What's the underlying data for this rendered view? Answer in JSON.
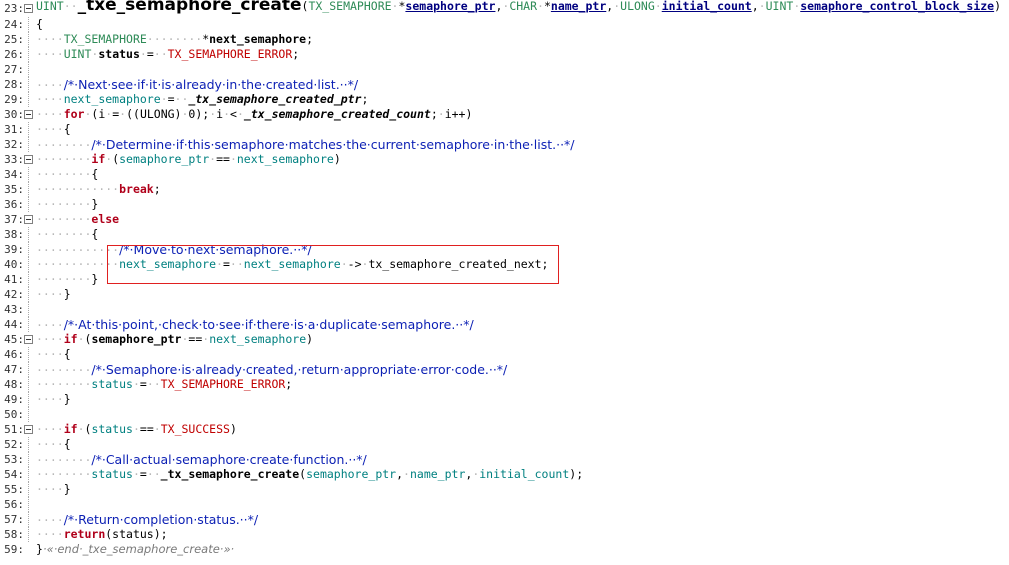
{
  "lines": [
    {
      "n": "23",
      "fold": true,
      "guide": false,
      "tokens": [
        [
          "type",
          "UINT"
        ],
        [
          "ws",
          "··"
        ],
        [
          "func",
          "_txe_semaphore_create"
        ],
        [
          "plain",
          "("
        ],
        [
          "type",
          "TX_SEMAPHORE"
        ],
        [
          "ws",
          "·"
        ],
        [
          "plain",
          "*"
        ],
        [
          "param",
          "semaphore_ptr"
        ],
        [
          "plain",
          ","
        ],
        [
          "ws",
          "·"
        ],
        [
          "type",
          "CHAR"
        ],
        [
          "ws",
          "·"
        ],
        [
          "plain",
          "*"
        ],
        [
          "param",
          "name_ptr"
        ],
        [
          "plain",
          ","
        ],
        [
          "ws",
          "·"
        ],
        [
          "type",
          "ULONG"
        ],
        [
          "ws",
          "·"
        ],
        [
          "param",
          "initial_count"
        ],
        [
          "plain",
          ","
        ],
        [
          "ws",
          "·"
        ],
        [
          "type",
          "UINT"
        ],
        [
          "ws",
          "·"
        ],
        [
          "param",
          "semaphore_control_block_size"
        ],
        [
          "plain",
          ")"
        ]
      ]
    },
    {
      "n": "24",
      "fold": false,
      "guide": true,
      "tokens": [
        [
          "plain",
          "{"
        ]
      ]
    },
    {
      "n": "25",
      "fold": false,
      "guide": true,
      "tokens": [
        [
          "ws",
          "····"
        ],
        [
          "type",
          "TX_SEMAPHORE"
        ],
        [
          "ws",
          "········"
        ],
        [
          "plain",
          "*"
        ],
        [
          "var",
          "next_semaphore"
        ],
        [
          "plain",
          ";"
        ]
      ]
    },
    {
      "n": "26",
      "fold": false,
      "guide": true,
      "tokens": [
        [
          "ws",
          "····"
        ],
        [
          "type",
          "UINT"
        ],
        [
          "ws",
          "·"
        ],
        [
          "var",
          "status"
        ],
        [
          "ws",
          "·"
        ],
        [
          "plain",
          "="
        ],
        [
          "ws",
          "··"
        ],
        [
          "const",
          "TX_SEMAPHORE_ERROR"
        ],
        [
          "plain",
          ";"
        ]
      ]
    },
    {
      "n": "27",
      "fold": false,
      "guide": true,
      "tokens": []
    },
    {
      "n": "28",
      "fold": false,
      "guide": true,
      "tokens": [
        [
          "ws",
          "····"
        ],
        [
          "comment",
          "/*·Next·see·if·it·is·already·in·the·created·list.··*/"
        ]
      ]
    },
    {
      "n": "29",
      "fold": false,
      "guide": true,
      "tokens": [
        [
          "ws",
          "····"
        ],
        [
          "ident",
          "next_semaphore"
        ],
        [
          "ws",
          "·"
        ],
        [
          "plain",
          "="
        ],
        [
          "ws",
          "··"
        ],
        [
          "global",
          "_tx_semaphore_created_ptr"
        ],
        [
          "plain",
          ";"
        ]
      ]
    },
    {
      "n": "30",
      "fold": true,
      "guide": false,
      "tokens": [
        [
          "ws",
          "····"
        ],
        [
          "keyword",
          "for"
        ],
        [
          "ws",
          "·"
        ],
        [
          "plain",
          "(i"
        ],
        [
          "ws",
          "·"
        ],
        [
          "plain",
          "="
        ],
        [
          "ws",
          "·"
        ],
        [
          "plain",
          "((ULONG)"
        ],
        [
          "ws",
          "·"
        ],
        [
          "plain",
          "0);"
        ],
        [
          "ws",
          "·"
        ],
        [
          "plain",
          "i"
        ],
        [
          "ws",
          "·"
        ],
        [
          "plain",
          "<"
        ],
        [
          "ws",
          "·"
        ],
        [
          "global",
          "_tx_semaphore_created_count"
        ],
        [
          "plain",
          ";"
        ],
        [
          "ws",
          "·"
        ],
        [
          "plain",
          "i++)"
        ]
      ]
    },
    {
      "n": "31",
      "fold": false,
      "guide": true,
      "tokens": [
        [
          "ws",
          "····"
        ],
        [
          "plain",
          "{"
        ]
      ]
    },
    {
      "n": "32",
      "fold": false,
      "guide": true,
      "tokens": [
        [
          "ws",
          "········"
        ],
        [
          "comment",
          "/*·Determine·if·this·semaphore·matches·the·current·semaphore·in·the·list.··*/"
        ]
      ]
    },
    {
      "n": "33",
      "fold": true,
      "guide": false,
      "tokens": [
        [
          "ws",
          "········"
        ],
        [
          "keyword",
          "if"
        ],
        [
          "ws",
          "·"
        ],
        [
          "plain",
          "("
        ],
        [
          "ident",
          "semaphore_ptr"
        ],
        [
          "ws",
          "·"
        ],
        [
          "plain",
          "=="
        ],
        [
          "ws",
          "·"
        ],
        [
          "ident",
          "next_semaphore"
        ],
        [
          "plain",
          ")"
        ]
      ]
    },
    {
      "n": "34",
      "fold": false,
      "guide": true,
      "tokens": [
        [
          "ws",
          "········"
        ],
        [
          "plain",
          "{"
        ]
      ]
    },
    {
      "n": "35",
      "fold": false,
      "guide": true,
      "tokens": [
        [
          "ws",
          "············"
        ],
        [
          "keyword",
          "break"
        ],
        [
          "plain",
          ";"
        ]
      ]
    },
    {
      "n": "36",
      "fold": false,
      "guide": true,
      "tokens": [
        [
          "ws",
          "········"
        ],
        [
          "plain",
          "}"
        ]
      ]
    },
    {
      "n": "37",
      "fold": true,
      "guide": false,
      "tokens": [
        [
          "ws",
          "········"
        ],
        [
          "keyword",
          "else"
        ]
      ]
    },
    {
      "n": "38",
      "fold": false,
      "guide": true,
      "tokens": [
        [
          "ws",
          "········"
        ],
        [
          "plain",
          "{"
        ]
      ]
    },
    {
      "n": "39",
      "fold": false,
      "guide": true,
      "tokens": [
        [
          "ws",
          "············"
        ],
        [
          "comment",
          "/*·Move·to·next·semaphore.··*/"
        ]
      ]
    },
    {
      "n": "40",
      "fold": false,
      "guide": true,
      "tokens": [
        [
          "ws",
          "············"
        ],
        [
          "ident",
          "next_semaphore"
        ],
        [
          "ws",
          "·"
        ],
        [
          "plain",
          "="
        ],
        [
          "ws",
          "··"
        ],
        [
          "ident",
          "next_semaphore"
        ],
        [
          "ws",
          "·"
        ],
        [
          "plain",
          "->"
        ],
        [
          "ws",
          "·"
        ],
        [
          "plain",
          "tx_semaphore_created_next;"
        ]
      ]
    },
    {
      "n": "41",
      "fold": false,
      "guide": true,
      "tokens": [
        [
          "ws",
          "········"
        ],
        [
          "plain",
          "}"
        ]
      ]
    },
    {
      "n": "42",
      "fold": false,
      "guide": true,
      "tokens": [
        [
          "ws",
          "····"
        ],
        [
          "plain",
          "}"
        ]
      ]
    },
    {
      "n": "43",
      "fold": false,
      "guide": true,
      "tokens": []
    },
    {
      "n": "44",
      "fold": false,
      "guide": true,
      "tokens": [
        [
          "ws",
          "····"
        ],
        [
          "comment",
          "/*·At·this·point,·check·to·see·if·there·is·a·duplicate·semaphore.··*/"
        ]
      ]
    },
    {
      "n": "45",
      "fold": true,
      "guide": false,
      "tokens": [
        [
          "ws",
          "····"
        ],
        [
          "keyword",
          "if"
        ],
        [
          "ws",
          "·"
        ],
        [
          "plain",
          "("
        ],
        [
          "var",
          "semaphore_ptr"
        ],
        [
          "ws",
          "·"
        ],
        [
          "plain",
          "=="
        ],
        [
          "ws",
          "·"
        ],
        [
          "ident",
          "next_semaphore"
        ],
        [
          "plain",
          ")"
        ]
      ]
    },
    {
      "n": "46",
      "fold": false,
      "guide": true,
      "tokens": [
        [
          "ws",
          "····"
        ],
        [
          "plain",
          "{"
        ]
      ]
    },
    {
      "n": "47",
      "fold": false,
      "guide": true,
      "tokens": [
        [
          "ws",
          "········"
        ],
        [
          "comment",
          "/*·Semaphore·is·already·created,·return·appropriate·error·code.··*/"
        ]
      ]
    },
    {
      "n": "48",
      "fold": false,
      "guide": true,
      "tokens": [
        [
          "ws",
          "········"
        ],
        [
          "ident",
          "status"
        ],
        [
          "ws",
          "·"
        ],
        [
          "plain",
          "="
        ],
        [
          "ws",
          "··"
        ],
        [
          "const",
          "TX_SEMAPHORE_ERROR"
        ],
        [
          "plain",
          ";"
        ]
      ]
    },
    {
      "n": "49",
      "fold": false,
      "guide": true,
      "tokens": [
        [
          "ws",
          "····"
        ],
        [
          "plain",
          "}"
        ]
      ]
    },
    {
      "n": "50",
      "fold": false,
      "guide": true,
      "tokens": []
    },
    {
      "n": "51",
      "fold": true,
      "guide": false,
      "tokens": [
        [
          "ws",
          "····"
        ],
        [
          "keyword",
          "if"
        ],
        [
          "ws",
          "·"
        ],
        [
          "plain",
          "("
        ],
        [
          "ident",
          "status"
        ],
        [
          "ws",
          "·"
        ],
        [
          "plain",
          "=="
        ],
        [
          "ws",
          "·"
        ],
        [
          "const",
          "TX_SUCCESS"
        ],
        [
          "plain",
          ")"
        ]
      ]
    },
    {
      "n": "52",
      "fold": false,
      "guide": true,
      "tokens": [
        [
          "ws",
          "····"
        ],
        [
          "plain",
          "{"
        ]
      ]
    },
    {
      "n": "53",
      "fold": false,
      "guide": true,
      "tokens": [
        [
          "ws",
          "········"
        ],
        [
          "comment",
          "/*·Call·actual·semaphore·create·function.··*/"
        ]
      ]
    },
    {
      "n": "54",
      "fold": false,
      "guide": true,
      "tokens": [
        [
          "ws",
          "········"
        ],
        [
          "ident",
          "status"
        ],
        [
          "ws",
          "·"
        ],
        [
          "plain",
          "="
        ],
        [
          "ws",
          "··"
        ],
        [
          "call",
          "_tx_semaphore_create"
        ],
        [
          "plain",
          "("
        ],
        [
          "ident",
          "semaphore_ptr"
        ],
        [
          "plain",
          ","
        ],
        [
          "ws",
          "·"
        ],
        [
          "ident",
          "name_ptr"
        ],
        [
          "plain",
          ","
        ],
        [
          "ws",
          "·"
        ],
        [
          "ident",
          "initial_count"
        ],
        [
          "plain",
          ");"
        ]
      ]
    },
    {
      "n": "55",
      "fold": false,
      "guide": true,
      "tokens": [
        [
          "ws",
          "····"
        ],
        [
          "plain",
          "}"
        ]
      ]
    },
    {
      "n": "56",
      "fold": false,
      "guide": true,
      "tokens": []
    },
    {
      "n": "57",
      "fold": false,
      "guide": true,
      "tokens": [
        [
          "ws",
          "····"
        ],
        [
          "comment",
          "/*·Return·completion·status.··*/"
        ]
      ]
    },
    {
      "n": "58",
      "fold": false,
      "guide": true,
      "tokens": [
        [
          "ws",
          "····"
        ],
        [
          "keyword",
          "return"
        ],
        [
          "plain",
          "(status);"
        ]
      ]
    },
    {
      "n": "59",
      "fold": false,
      "guide": false,
      "tokens": [
        [
          "plain",
          "}"
        ],
        [
          "endcomment",
          "·«·end·_txe_semaphore_create·»·"
        ]
      ]
    }
  ]
}
